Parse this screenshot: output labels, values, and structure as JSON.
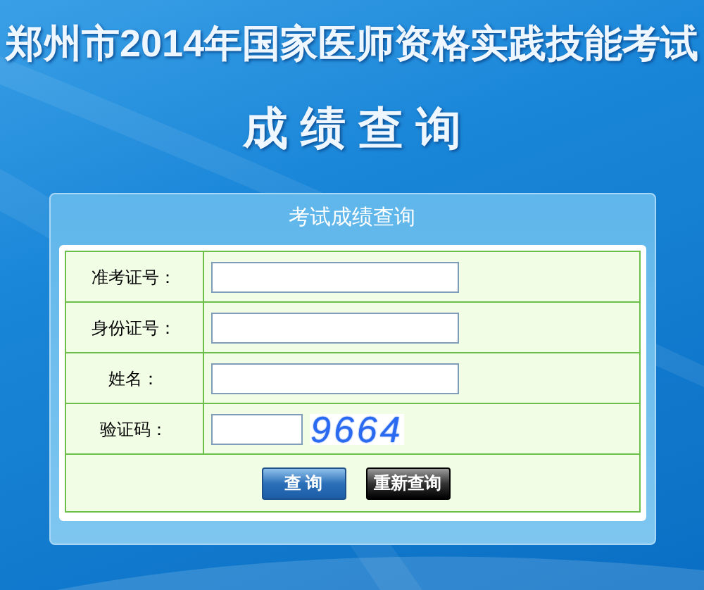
{
  "header": {
    "title": "郑州市2014年国家医师资格实践技能考试",
    "subtitle": "成 绩 查 询"
  },
  "panel": {
    "title": "考试成绩查询",
    "fields": [
      {
        "label": "准考证号：",
        "kind": "text"
      },
      {
        "label": "身份证号：",
        "kind": "text"
      },
      {
        "label": "姓名：",
        "kind": "text"
      },
      {
        "label": "验证码：",
        "kind": "captcha",
        "captcha": "9664"
      }
    ],
    "buttons": [
      {
        "label": "查 询",
        "kind": "primary"
      },
      {
        "label": "重新查询",
        "kind": "dark"
      }
    ]
  }
}
